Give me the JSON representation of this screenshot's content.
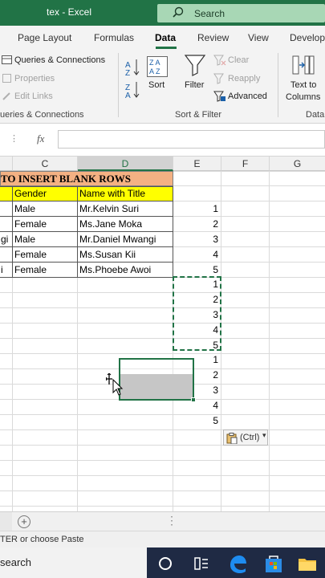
{
  "app": {
    "title": "tex  -  Excel",
    "search_placeholder": "Search",
    "accent_color": "#217346"
  },
  "tabs": [
    "Page Layout",
    "Formulas",
    "Data",
    "Review",
    "View",
    "Develop"
  ],
  "active_tab": "Data",
  "ribbon": {
    "queries_connections": "Queries & Connections",
    "properties": "Properties",
    "edit_links": "Edit Links",
    "queries_group": "ueries & Connections",
    "sort": "Sort",
    "filter": "Filter",
    "clear": "Clear",
    "reapply": "Reapply",
    "advanced": "Advanced",
    "sort_filter_group": "Sort & Filter",
    "text_to_columns_1": "Text to",
    "text_to_columns_2": "Columns",
    "data_group": "Data"
  },
  "formula_bar": {
    "fx": "fx",
    "value": ""
  },
  "columns": [
    "C",
    "D",
    "E",
    "F",
    "G"
  ],
  "selected_column": "D",
  "sheet": {
    "heading": "TO INSERT BLANK ROWS",
    "header_row": [
      "Gender",
      "Name with Title"
    ],
    "rows": [
      {
        "b_tail": "",
        "gender": "Male",
        "name": "Mr.Kelvin Suri",
        "e": "1"
      },
      {
        "b_tail": "",
        "gender": "Female",
        "name": "Ms.Jane Moka",
        "e": "2"
      },
      {
        "b_tail": "gi",
        "gender": "Male",
        "name": "Mr.Daniel Mwangi",
        "e": "3"
      },
      {
        "b_tail": "",
        "gender": "Female",
        "name": "Ms.Susan Kii",
        "e": "4"
      },
      {
        "b_tail": "i",
        "gender": "Female",
        "name": "Ms.Phoebe Awoi",
        "e": "5"
      }
    ],
    "copied_numbers": [
      "1",
      "2",
      "3",
      "4",
      "5"
    ],
    "pasted_numbers": [
      "1",
      "2",
      "3",
      "4",
      "5"
    ],
    "paste_options_label": "(Ctrl)",
    "heading_color": "#f4b183",
    "header_color": "#ffff00"
  },
  "status": {
    "text": "TER or choose Paste"
  },
  "taskbar": {
    "search_text": "search"
  }
}
